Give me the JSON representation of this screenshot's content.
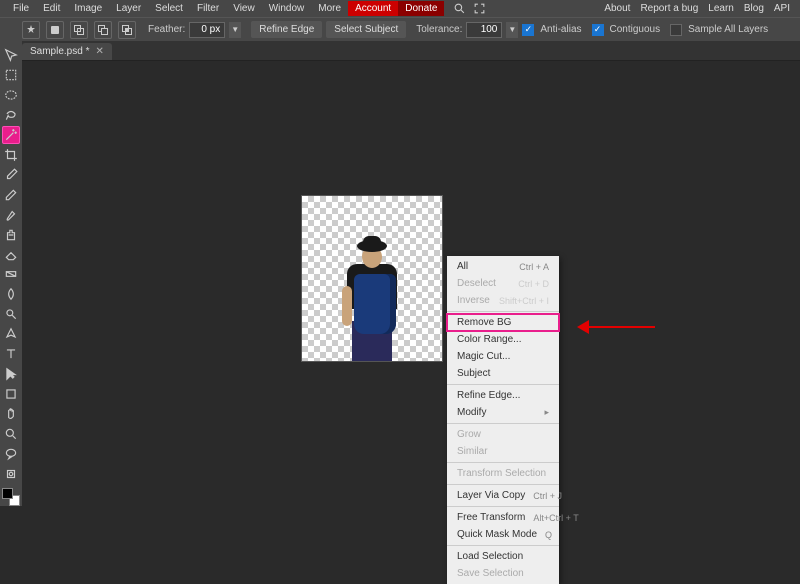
{
  "menu": {
    "items": [
      "File",
      "Edit",
      "Image",
      "Layer",
      "Select",
      "Filter",
      "View",
      "Window",
      "More"
    ],
    "account": "Account",
    "donate": "Donate"
  },
  "rightmenu": [
    "About",
    "Report a bug",
    "Learn",
    "Blog",
    "API"
  ],
  "optbar": {
    "feather_label": "Feather:",
    "feather_val": "0 px",
    "refine": "Refine Edge",
    "subject": "Select Subject",
    "tol_label": "Tolerance:",
    "tol_val": "100",
    "anti": "Anti-alias",
    "contig": "Contiguous",
    "samp": "Sample All Layers"
  },
  "tab": {
    "name": "Sample.psd *"
  },
  "tools": [
    "move",
    "rect-marquee",
    "ellipse-marquee",
    "lasso",
    "magic-wand",
    "crop",
    "eyedropper",
    "pencil",
    "brush",
    "clone",
    "eraser",
    "gradient",
    "blur",
    "dodge",
    "pen",
    "text",
    "path-select",
    "rect-shape",
    "hand",
    "zoom",
    "notes",
    "tool-21"
  ],
  "ctx": [
    {
      "label": "All",
      "sc": "Ctrl + A",
      "d": false
    },
    {
      "label": "Deselect",
      "sc": "Ctrl + D",
      "d": true
    },
    {
      "label": "Inverse",
      "sc": "Shift+Ctrl + I",
      "d": true
    },
    {
      "sep": true
    },
    {
      "label": "Remove BG",
      "hl": true
    },
    {
      "label": "Color Range..."
    },
    {
      "label": "Magic Cut..."
    },
    {
      "label": "Subject"
    },
    {
      "sep": true
    },
    {
      "label": "Refine Edge..."
    },
    {
      "label": "Modify",
      "sub": true
    },
    {
      "sep": true
    },
    {
      "label": "Grow",
      "d": true
    },
    {
      "label": "Similar",
      "d": true
    },
    {
      "sep": true
    },
    {
      "label": "Transform Selection",
      "d": true
    },
    {
      "sep": true
    },
    {
      "label": "Layer Via Copy",
      "sc": "Ctrl + J"
    },
    {
      "sep": true
    },
    {
      "label": "Free Transform",
      "sc": "Alt+Ctrl + T"
    },
    {
      "label": "Quick Mask Mode",
      "sc": "Q"
    },
    {
      "sep": true
    },
    {
      "label": "Load Selection"
    },
    {
      "label": "Save Selection",
      "d": true
    }
  ]
}
